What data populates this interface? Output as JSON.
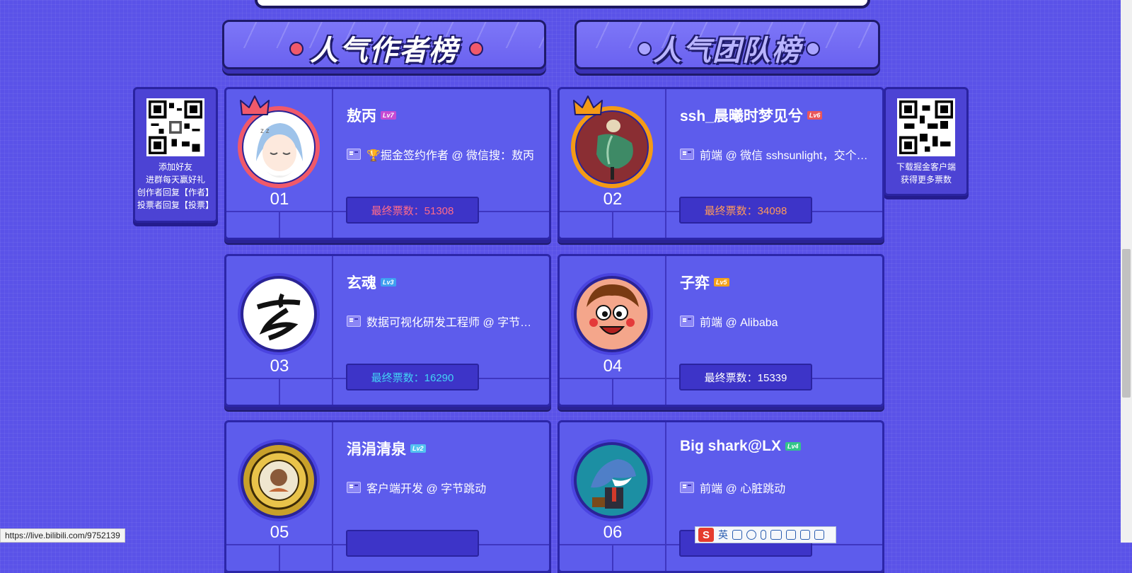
{
  "tabs": [
    {
      "label": "人气作者榜",
      "active": true
    },
    {
      "label": "人气团队榜",
      "active": false
    }
  ],
  "left_panel": {
    "lines": [
      "添加好友",
      "进群每天赢好礼",
      "创作者回复【作者】",
      "投票者回复【投票】"
    ]
  },
  "right_panel": {
    "lines": [
      "下载掘金客户端",
      "获得更多票数"
    ]
  },
  "authors": [
    {
      "rank": "01",
      "name": "敖丙",
      "level": "Lv7",
      "level_color": "#c64bd3",
      "desc": "🏆掘金签约作者 @ 微信搜：敖丙",
      "votes": "最终票数：51308",
      "vote_color": "#ff6b8a",
      "ring_color": "#f0596a",
      "crown": true,
      "crown_color": "#f0596a",
      "avatar": "anime-character-icon"
    },
    {
      "rank": "02",
      "name": "ssh_晨曦时梦见兮",
      "level": "Lv6",
      "level_color": "#e9565a",
      "desc": "前端 @ 微信 sshsunlight，交个…",
      "votes": "最终票数：34098",
      "vote_color": "#ff9a5a",
      "ring_color": "#f49a16",
      "crown": true,
      "crown_color": "#f49a16",
      "avatar": "painting-figure-icon"
    },
    {
      "rank": "03",
      "name": "玄魂",
      "level": "Lv3",
      "level_color": "#3fa0f0",
      "desc": "数据可视化研发工程师 @ 字节…",
      "votes": "最终票数：16290",
      "vote_color": "#43d2f5",
      "ring_color": "#4a44e0",
      "crown": false,
      "avatar": "calligraphy-icon"
    },
    {
      "rank": "04",
      "name": "子弈",
      "level": "Lv5",
      "level_color": "#f3a21a",
      "desc": "前端 @ Alibaba",
      "votes": "最终票数：15339",
      "vote_color": "#ffffff",
      "ring_color": "#4a44e0",
      "crown": false,
      "avatar": "cartoon-face-icon"
    },
    {
      "rank": "05",
      "name": "涓涓清泉",
      "level": "Lv2",
      "level_color": "#53c2f0",
      "desc": "客户端开发 @ 字节跳动",
      "votes": "",
      "vote_color": "#ffffff",
      "ring_color": "#4a44e0",
      "crown": false,
      "avatar": "university-seal-icon"
    },
    {
      "rank": "06",
      "name": "Big shark@LX",
      "level": "Lv4",
      "level_color": "#33c48a",
      "desc": "前端 @ 心脏跳动",
      "votes": "",
      "vote_color": "#ffffff",
      "ring_color": "#4a44e0",
      "crown": false,
      "avatar": "shark-icon"
    }
  ],
  "status_bar": {
    "url": "https://live.bilibili.com/9752139"
  },
  "ime": {
    "logo": "S",
    "mode": "英"
  }
}
